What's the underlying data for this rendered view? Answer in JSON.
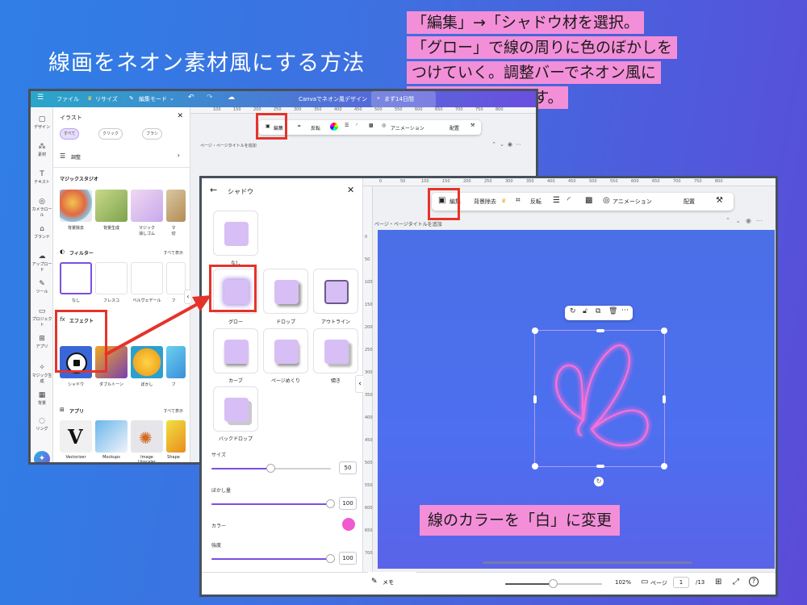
{
  "heading": "線画をネオン素材風にする方法",
  "callout_lines": [
    "「編集」→「シャドウ材を選択。",
    "「グロー」で線の周りに色のぼかしを",
    "つけていく。調整バーでネオン風に",
    "みえるところを探す。"
  ],
  "bottom_callout": "線のカラーを「白」に変更",
  "window1": {
    "topbar": {
      "menu_icon": "menu-icon",
      "file": "ファイル",
      "resize": "リサイズ",
      "edit_mode": "編集モード",
      "title": "Canvaでネオン風デザイン",
      "trial": "まず14日間"
    },
    "rail": [
      "デザイン",
      "素材",
      "テキスト",
      "カメラロール",
      "ブランド",
      "アップロード",
      "ツール",
      "プロジェクト",
      "アプリ",
      "マジック生成",
      "背景",
      "リング"
    ],
    "panel": {
      "title": "イラスト",
      "chips": [
        "すべて",
        "クリック",
        "ブラシ"
      ],
      "adjust": "調整",
      "magic_studio": "マジックスタジオ",
      "magic_items": [
        "背景除去",
        "背景生成",
        "マジック\n消しゴム",
        "マ\n切"
      ],
      "filters": "フィルター",
      "filters_more": "すべて表示",
      "filter_items": [
        "なし",
        "フレスコ",
        "ベルヴェデール",
        "フ"
      ],
      "effects": "エフェクト",
      "effect_items": [
        "シャドウ",
        "ダブルトーン",
        "ぼかし",
        "フ"
      ],
      "apps": "アプリ",
      "apps_more": "すべて表示",
      "app_items": [
        "Vectorizer",
        "Mockups",
        "Image\nUpscaler",
        "Shape"
      ]
    },
    "toolbar": [
      "編集",
      "反転",
      "アニメーション",
      "配置"
    ],
    "page_title": "ページ・ページタイトルを追加",
    "ruler": [
      "100",
      "150",
      "200",
      "250",
      "300",
      "350",
      "400",
      "450",
      "500",
      "550",
      "600",
      "650",
      "700",
      "750",
      "800"
    ]
  },
  "window2": {
    "panel": {
      "back_icon": "back-arrow-icon",
      "title": "シャドウ",
      "options": [
        "なし",
        "グロー",
        "ドロップ",
        "アウトライン",
        "カーブ",
        "ページめくり",
        "傾き",
        "バックドロップ"
      ],
      "sliders": [
        {
          "label": "サイズ",
          "value": "50",
          "fraction": 0.5
        },
        {
          "label": "ぼかし量",
          "value": "100",
          "fraction": 1.0
        },
        {
          "label": "強度",
          "value": "100",
          "fraction": 1.0
        }
      ],
      "color_label": "カラー",
      "color_value": "#f05ad0"
    },
    "toolbar": [
      "編集",
      "背景除去",
      "反転",
      "アニメーション",
      "配置"
    ],
    "page_title": "ページ・ページタイトルを追加",
    "ruler_top": [
      "0",
      "50",
      "100",
      "150",
      "200",
      "250",
      "300",
      "350",
      "400",
      "450",
      "500",
      "550",
      "600",
      "650",
      "700",
      "750",
      "800"
    ],
    "ruler_left": [
      "0",
      "50",
      "100",
      "150",
      "200",
      "250",
      "300",
      "350",
      "400",
      "450",
      "500",
      "550",
      "600",
      "650",
      "700"
    ],
    "bottom": {
      "memo": "メモ",
      "zoom": "102%",
      "page_label": "ページ",
      "page_current": "1",
      "page_total": "/13",
      "zoom_fraction": 0.5
    }
  },
  "colors": {
    "accent": "#7b4fe0",
    "callout_pink": "#f38fd8",
    "highlight_red": "#e5332a",
    "neon": "#ff6fd8"
  }
}
